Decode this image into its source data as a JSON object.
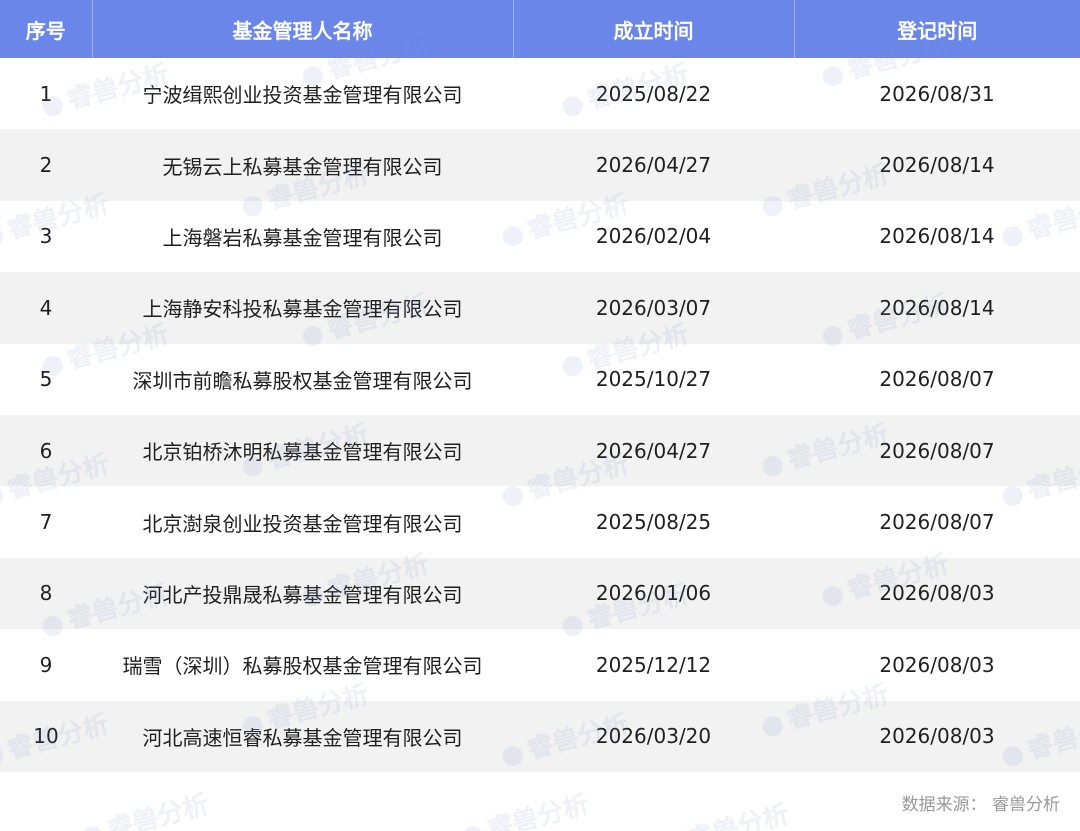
{
  "table": {
    "headers": [
      "序号",
      "基金管理人名称",
      "成立时间",
      "登记时间"
    ],
    "rows": [
      {
        "idx": "1",
        "name": "宁波缉熙创业投资基金管理有限公司",
        "established": "2025/08/22",
        "registered": "2026/08/31"
      },
      {
        "idx": "2",
        "name": "无锡云上私募基金管理有限公司",
        "established": "2026/04/27",
        "registered": "2026/08/14"
      },
      {
        "idx": "3",
        "name": "上海磐岩私募基金管理有限公司",
        "established": "2026/02/04",
        "registered": "2026/08/14"
      },
      {
        "idx": "4",
        "name": "上海静安科投私募基金管理有限公司",
        "established": "2026/03/07",
        "registered": "2026/08/14"
      },
      {
        "idx": "5",
        "name": "深圳市前瞻私募股权基金管理有限公司",
        "established": "2025/10/27",
        "registered": "2026/08/07"
      },
      {
        "idx": "6",
        "name": "北京铂桥沐明私募基金管理有限公司",
        "established": "2026/04/27",
        "registered": "2026/08/07"
      },
      {
        "idx": "7",
        "name": "北京澍泉创业投资基金管理有限公司",
        "established": "2025/08/25",
        "registered": "2026/08/07"
      },
      {
        "idx": "8",
        "name": "河北产投鼎晟私募基金管理有限公司",
        "established": "2026/01/06",
        "registered": "2026/08/03"
      },
      {
        "idx": "9",
        "name": "瑞雪（深圳）私募股权基金管理有限公司",
        "established": "2025/12/12",
        "registered": "2026/08/03"
      },
      {
        "idx": "10",
        "name": "河北高速恒睿私募基金管理有限公司",
        "established": "2026/03/20",
        "registered": "2026/08/03"
      }
    ]
  },
  "source_note": "数据来源：  睿兽分析",
  "watermark": {
    "text": "睿兽分析",
    "logo_icon": "paw-logo-icon"
  },
  "colors": {
    "header_bg": "#6a86e8",
    "stripe_bg": "#f2f2f2",
    "header_text": "#ffffff",
    "body_text": "#1f1f1f"
  }
}
